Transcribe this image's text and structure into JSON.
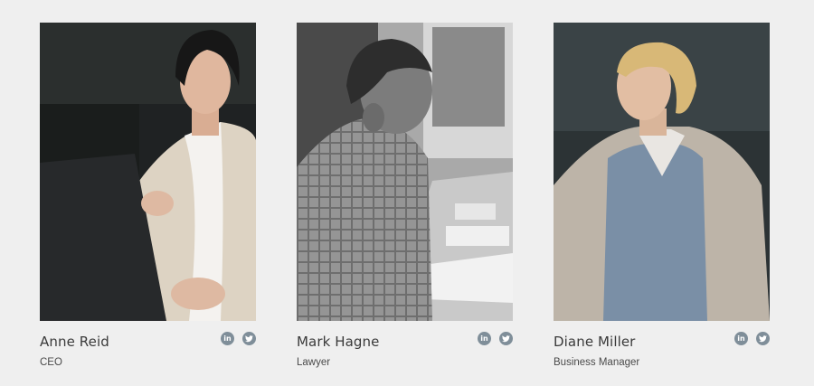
{
  "members": [
    {
      "name": "Anne Reid",
      "role": "CEO",
      "linkedin_icon": "in",
      "twitter_icon": "twitter-bird"
    },
    {
      "name": "Mark Hagne",
      "role": "Lawyer",
      "linkedin_icon": "in",
      "twitter_icon": "twitter-bird"
    },
    {
      "name": "Diane Miller",
      "role": "Business Manager",
      "linkedin_icon": "in",
      "twitter_icon": "twitter-bird"
    }
  ],
  "colors": {
    "background": "#efefef",
    "social_icon_bg": "#7f8e99",
    "name_text": "#3a3a3a"
  }
}
